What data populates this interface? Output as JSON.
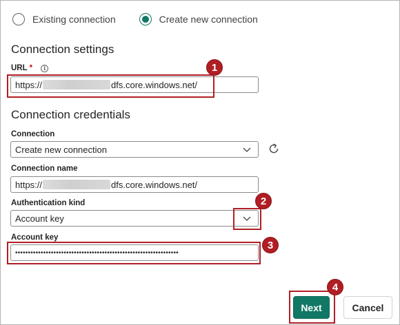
{
  "radios": {
    "existing_label": "Existing connection",
    "new_label": "Create new connection",
    "selected": "new"
  },
  "settings": {
    "title": "Connection settings",
    "url_label": "URL",
    "required_mark": "*",
    "url_prefix": "https://",
    "url_suffix": "dfs.core.windows.net/"
  },
  "credentials": {
    "title": "Connection credentials",
    "connection_label": "Connection",
    "connection_value": "Create new connection",
    "name_label": "Connection name",
    "name_prefix": "https://",
    "name_suffix": "dfs.core.windows.net/",
    "auth_label": "Authentication kind",
    "auth_value": "Account key",
    "key_label": "Account key",
    "key_value": "••••••••••••••••••••••••••••••••••••••••••••••••••••••••••••••••"
  },
  "annotations": [
    "1",
    "2",
    "3",
    "4"
  ],
  "buttons": {
    "next": "Next",
    "cancel": "Cancel"
  },
  "colors": {
    "accent": "#117865",
    "annotation": "#b01e24"
  },
  "icons": [
    "info-icon",
    "chevron-down-icon",
    "refresh-icon"
  ]
}
